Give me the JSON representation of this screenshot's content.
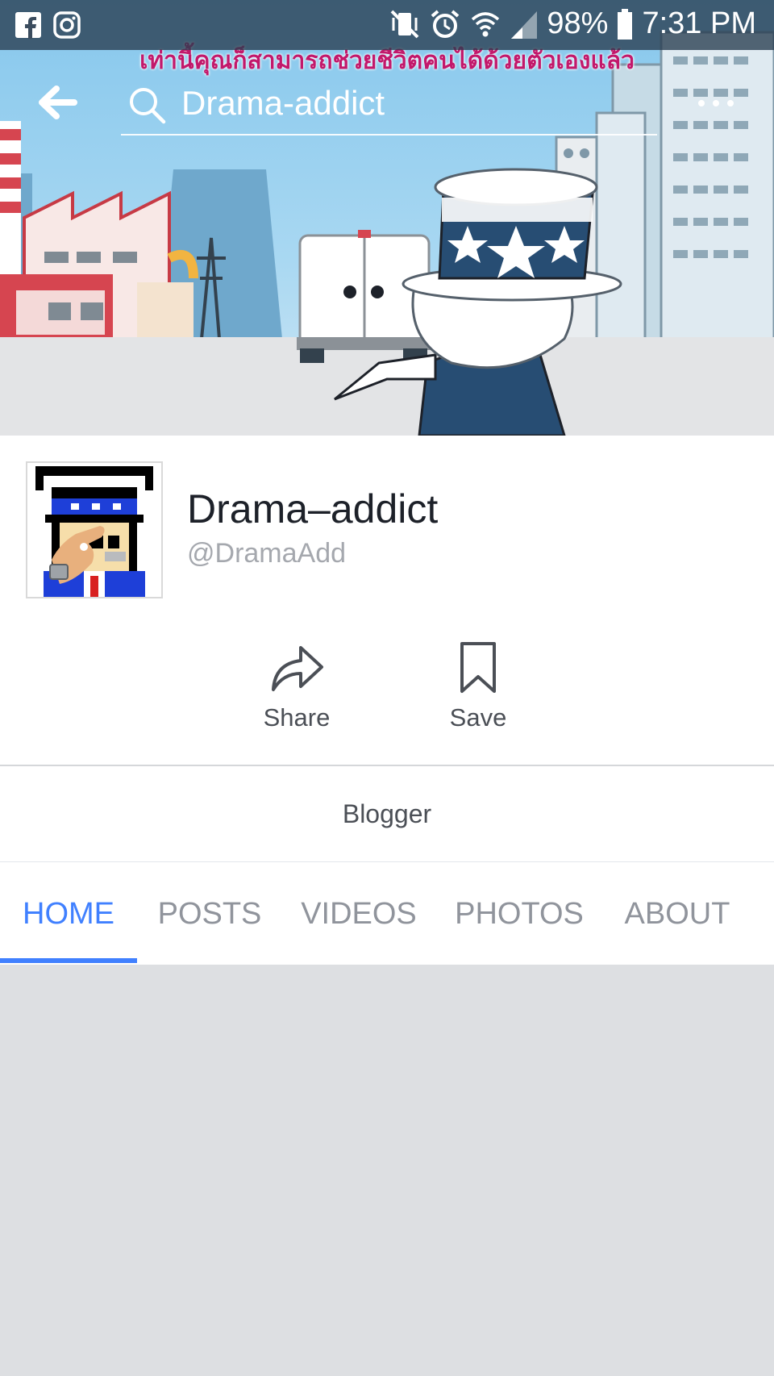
{
  "status_bar": {
    "battery": "98%",
    "time": "7:31 PM",
    "left_icons": [
      "facebook-icon",
      "instagram-icon"
    ],
    "right_icons": [
      "vibrate-mute-icon",
      "alarm-icon",
      "wifi-icon",
      "signal-icon",
      "battery-icon"
    ]
  },
  "cover": {
    "caption": "เท่านี้คุณก็สามารถช่วยชีวิตคนได้ด้วยตัวเองแล้ว"
  },
  "nav": {
    "search_text": "Drama-addict"
  },
  "profile": {
    "name": "Drama–addict",
    "handle": "@DramaAdd"
  },
  "actions": {
    "share_label": "Share",
    "save_label": "Save"
  },
  "category": "Blogger",
  "tabs": [
    {
      "label": "HOME",
      "active": true
    },
    {
      "label": "POSTS",
      "active": false
    },
    {
      "label": "VIDEOS",
      "active": false
    },
    {
      "label": "PHOTOS",
      "active": false
    },
    {
      "label": "ABOUT",
      "active": false
    }
  ],
  "colors": {
    "accent": "#4080ff",
    "caption": "#c2186b",
    "feed_bg": "#dddfe2"
  }
}
